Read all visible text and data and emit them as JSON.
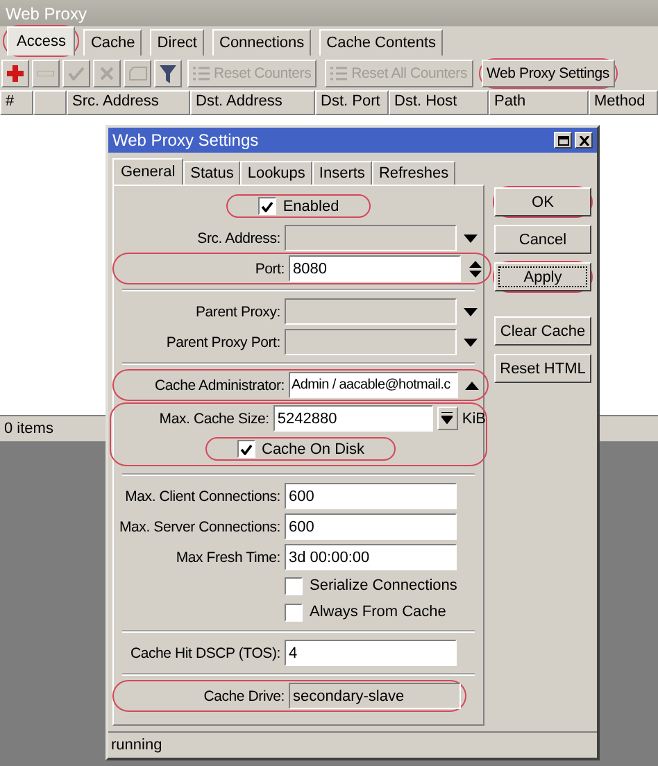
{
  "window": {
    "title": "Web Proxy"
  },
  "tabs": [
    {
      "label": "Access",
      "selected": true,
      "highlighted": true
    },
    {
      "label": "Cache",
      "selected": false,
      "highlighted": false
    },
    {
      "label": "Direct",
      "selected": false,
      "highlighted": false
    },
    {
      "label": "Connections",
      "selected": false,
      "highlighted": false
    },
    {
      "label": "Cache Contents",
      "selected": false,
      "highlighted": false
    }
  ],
  "toolbar": [
    {
      "kind": "add",
      "disabled": false
    },
    {
      "kind": "remove",
      "disabled": true
    },
    {
      "kind": "enable",
      "disabled": true
    },
    {
      "kind": "disable",
      "disabled": true
    },
    {
      "kind": "comment",
      "disabled": true
    },
    {
      "kind": "filter",
      "disabled": false
    },
    {
      "kind": "text",
      "label": "Reset Counters",
      "disabled": true,
      "highlighted": false
    },
    {
      "kind": "text",
      "label": "Reset All Counters",
      "disabled": true,
      "highlighted": false
    },
    {
      "kind": "text",
      "label": "Web Proxy Settings",
      "disabled": false,
      "highlighted": true
    }
  ],
  "table": {
    "columns": [
      "#",
      "Src. Address",
      "Dst. Address",
      "Dst. Port",
      "Dst. Host",
      "Path",
      "Method"
    ]
  },
  "status_bar": "0 items",
  "dialog": {
    "title": "Web Proxy Settings",
    "tabs": [
      {
        "label": "General",
        "selected": true
      },
      {
        "label": "Status",
        "selected": false
      },
      {
        "label": "Lookups",
        "selected": false
      },
      {
        "label": "Inserts",
        "selected": false
      },
      {
        "label": "Refreshes",
        "selected": false
      }
    ],
    "fields": [
      {
        "kind": "checkbox",
        "label": "Enabled",
        "checked": true,
        "highlighted": true
      },
      {
        "kind": "dropdown",
        "label": "Src. Address:",
        "disabled": true
      },
      {
        "kind": "spinner",
        "label": "Port:",
        "value": "8080",
        "highlighted": true
      },
      {
        "kind": "separator"
      },
      {
        "kind": "dropdown",
        "label": "Parent Proxy:",
        "disabled": true
      },
      {
        "kind": "dropdown",
        "label": "Parent Proxy Port:",
        "disabled": true
      },
      {
        "kind": "separator"
      },
      {
        "kind": "collapse",
        "label": "Cache Administrator:",
        "value": "Admin / aacable@hotmail.c",
        "highlighted": true
      },
      {
        "kind": "group",
        "highlighted": true,
        "children": [
          {
            "kind": "unit",
            "label": "Max. Cache Size:",
            "value": "5242880",
            "unit": "KiB"
          },
          {
            "kind": "checkbox",
            "label": "Cache On Disk",
            "checked": true,
            "highlighted": true
          }
        ]
      },
      {
        "kind": "separator"
      },
      {
        "kind": "input",
        "label": "Max. Client Connections:",
        "value": "600"
      },
      {
        "kind": "input",
        "label": "Max. Server Connections:",
        "value": "600"
      },
      {
        "kind": "input",
        "label": "Max Fresh Time:",
        "value": "3d 00:00:00"
      },
      {
        "kind": "checkbox",
        "label": "Serialize Connections",
        "checked": false,
        "highlighted": false
      },
      {
        "kind": "checkbox",
        "label": "Always From Cache",
        "checked": false,
        "highlighted": false
      },
      {
        "kind": "separator"
      },
      {
        "kind": "input",
        "label": "Cache Hit DSCP (TOS):",
        "value": "4"
      },
      {
        "kind": "separator"
      },
      {
        "kind": "readonly",
        "label": "Cache Drive:",
        "value": "secondary-slave",
        "highlighted": true
      }
    ],
    "buttons": [
      {
        "label": "OK",
        "highlighted": true,
        "focused": false
      },
      {
        "label": "Cancel",
        "highlighted": false,
        "focused": false
      },
      {
        "label": "Apply",
        "highlighted": true,
        "focused": true
      },
      {
        "kind": "gap"
      },
      {
        "label": "Clear Cache",
        "highlighted": false,
        "focused": false
      },
      {
        "label": "Reset HTML",
        "highlighted": false,
        "focused": false
      }
    ],
    "status": "running"
  }
}
